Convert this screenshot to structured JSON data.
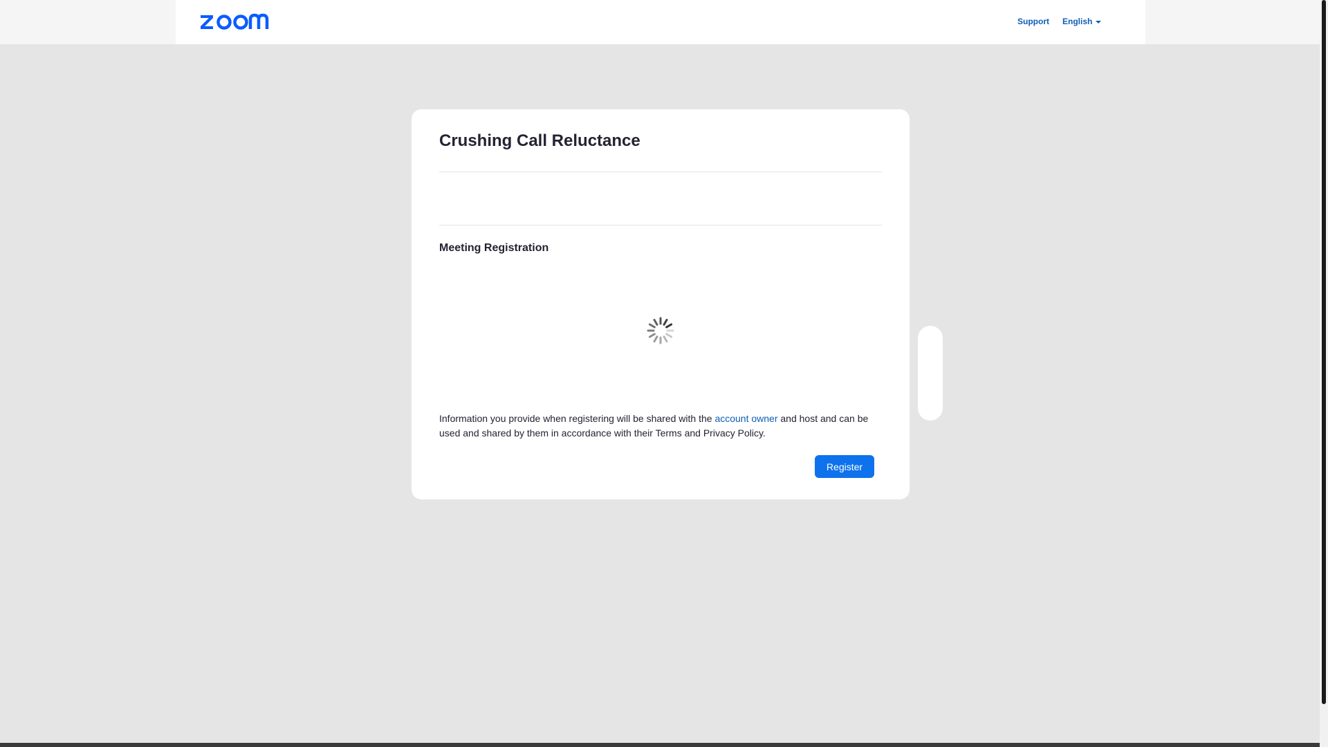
{
  "header": {
    "logo_text": "zoom",
    "support_label": "Support",
    "language_label": "English",
    "brand_color": "#0B5CFF",
    "link_color": "#0E5EB6"
  },
  "card": {
    "title": "Crushing Call Reluctance",
    "section_title": "Meeting Registration",
    "loading_icon": "spinner-icon",
    "disclaimer_before": "Information you provide when registering will be shared with the ",
    "disclaimer_link": "account owner",
    "disclaimer_after": " and host and can be used and shared by them in accordance with their Terms and Privacy Policy.",
    "register_label": "Register",
    "register_color": "#0E72ED"
  }
}
